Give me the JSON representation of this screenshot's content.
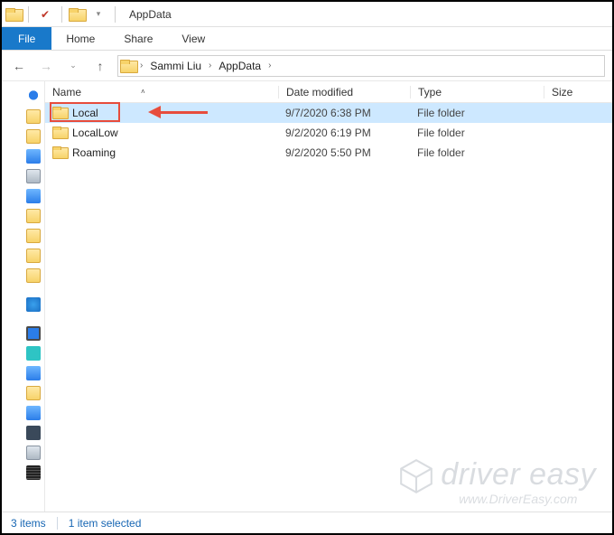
{
  "window": {
    "title": "AppData"
  },
  "tabs": {
    "file": "File",
    "home": "Home",
    "share": "Share",
    "view": "View"
  },
  "breadcrumbs": {
    "seg1": "Sammi Liu",
    "seg2": "AppData"
  },
  "columns": {
    "name": "Name",
    "date": "Date modified",
    "type": "Type",
    "size": "Size"
  },
  "items": [
    {
      "name": "Local",
      "date": "9/7/2020 6:38 PM",
      "type": "File folder",
      "selected": true
    },
    {
      "name": "LocalLow",
      "date": "9/2/2020 6:19 PM",
      "type": "File folder",
      "selected": false
    },
    {
      "name": "Roaming",
      "date": "9/2/2020 5:50 PM",
      "type": "File folder",
      "selected": false
    }
  ],
  "status": {
    "count": "3 items",
    "selection": "1 item selected"
  },
  "watermark": {
    "brand": "driver easy",
    "url": "www.DriverEasy.com"
  }
}
